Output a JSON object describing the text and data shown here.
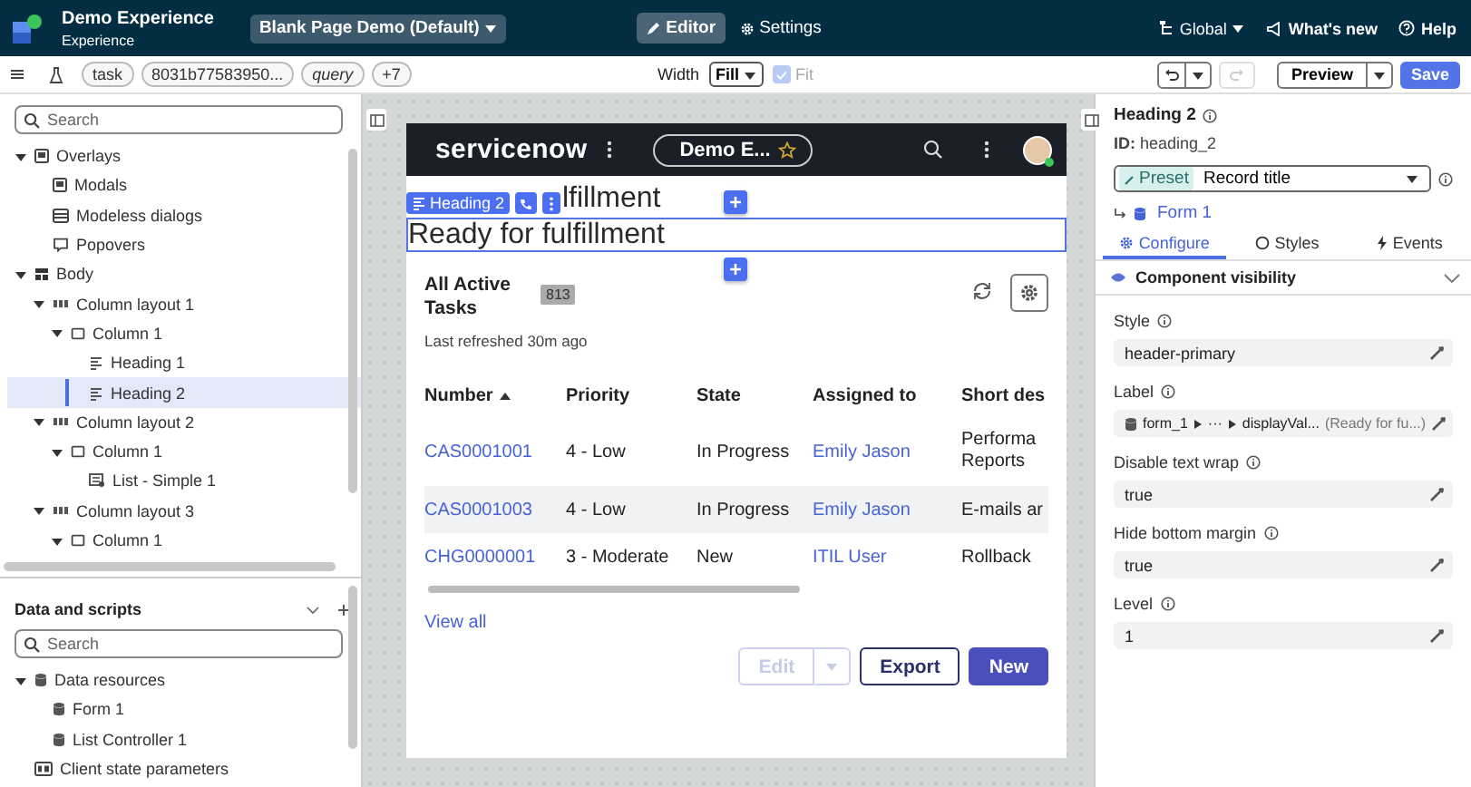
{
  "header": {
    "title": "Demo Experience",
    "subtitle": "Experience",
    "page_select": "Blank Page Demo (Default)",
    "tabs": [
      {
        "label": "Editor",
        "kind": "edit",
        "selected": true
      },
      {
        "label": "Settings",
        "kind": "settings",
        "selected": false
      }
    ],
    "links": [
      {
        "label": "Global",
        "kind": "scope"
      },
      {
        "label": "What's new",
        "kind": "news"
      },
      {
        "label": "Help",
        "kind": "help"
      }
    ]
  },
  "toolbar": {
    "params": [
      {
        "label": "task",
        "kind": "plain"
      },
      {
        "label": "8031b77583950...",
        "kind": "plain"
      },
      {
        "label": "query",
        "kind": "italic"
      },
      {
        "label": "+7",
        "kind": "plain"
      }
    ],
    "width_label": "Width",
    "width_value": "Fill",
    "fit": {
      "label": "Fit",
      "checked": true,
      "disabled": true
    },
    "undo": {
      "disabled": false
    },
    "redo": {
      "disabled": true
    },
    "preview": "Preview",
    "save": "Save"
  },
  "outline": {
    "search_placeholder": "Search",
    "tree": [
      {
        "label": "Overlays",
        "kind": "overlay",
        "expanded": true,
        "selected": false,
        "children": [
          {
            "label": "Modals",
            "kind": "overlay",
            "selected": false
          },
          {
            "label": "Modeless dialogs",
            "kind": "dialog",
            "selected": false
          },
          {
            "label": "Popovers",
            "kind": "popover",
            "selected": false
          }
        ]
      },
      {
        "label": "Body",
        "kind": "body",
        "expanded": true,
        "selected": false,
        "children": [
          {
            "label": "Column layout 1",
            "kind": "layout",
            "expanded": true,
            "selected": false,
            "children": [
              {
                "label": "Column 1",
                "kind": "column",
                "expanded": true,
                "selected": false,
                "children": [
                  {
                    "label": "Heading 1",
                    "kind": "heading",
                    "selected": false
                  },
                  {
                    "label": "Heading 2",
                    "kind": "heading",
                    "selected": true
                  }
                ]
              }
            ]
          },
          {
            "label": "Column layout 2",
            "kind": "layout",
            "expanded": true,
            "selected": false,
            "children": [
              {
                "label": "Column 1",
                "kind": "column",
                "expanded": true,
                "selected": false,
                "children": [
                  {
                    "label": "List - Simple 1",
                    "kind": "list",
                    "selected": false
                  }
                ]
              }
            ]
          },
          {
            "label": "Column layout 3",
            "kind": "layout",
            "expanded": true,
            "selected": false,
            "children": [
              {
                "label": "Column 1",
                "kind": "column",
                "expanded": true,
                "selected": false
              }
            ]
          }
        ]
      }
    ]
  },
  "data_scripts": {
    "title": "Data and scripts",
    "search_placeholder": "Search",
    "tree": [
      {
        "label": "Data resources",
        "kind": "data",
        "expanded": true,
        "selected": false,
        "children": [
          {
            "label": "Form 1",
            "kind": "data",
            "selected": false
          },
          {
            "label": "List Controller 1",
            "kind": "data",
            "selected": false
          }
        ]
      },
      {
        "label": "Client state parameters",
        "kind": "state",
        "selected": false
      }
    ]
  },
  "canvas": {
    "app_bar": {
      "logo": "servicenow",
      "pill": "Demo E..."
    },
    "chip": "Heading 2",
    "heading_1": "lfillment",
    "heading_2": "Ready for fulfillment",
    "list": {
      "title": "All Active Tasks",
      "count": "813",
      "refreshed": "Last refreshed 30m ago",
      "columns": [
        {
          "label": "Number",
          "kind": "link",
          "sorted": true
        },
        {
          "label": "Priority",
          "kind": "text",
          "sorted": false
        },
        {
          "label": "State",
          "kind": "text",
          "sorted": false
        },
        {
          "label": "Assigned to",
          "kind": "link",
          "sorted": false
        },
        {
          "label": "Short des",
          "kind": "text",
          "sorted": false
        }
      ],
      "rows": [
        {
          "cells": [
            "CAS0001001",
            "4 - Low",
            "In Progress",
            "Emily Jason",
            "Performa Reports"
          ],
          "highlighted": false
        },
        {
          "cells": [
            "CAS0001003",
            "4 - Low",
            "In Progress",
            "Emily Jason",
            "E-mails ar"
          ],
          "highlighted": true
        },
        {
          "cells": [
            "CHG0000001",
            "3 - Moderate",
            "New",
            "ITIL User",
            "Rollback"
          ],
          "highlighted": false
        }
      ],
      "view_all": "View all",
      "buttons": [
        {
          "label": "Edit",
          "kind": "split",
          "disabled": true
        },
        {
          "label": "Export",
          "kind": "outline",
          "disabled": false
        },
        {
          "label": "New",
          "kind": "primary",
          "disabled": false
        }
      ]
    }
  },
  "properties": {
    "title": "Heading 2",
    "id": "**ID:** heading_2",
    "preset": {
      "tag": "Preset",
      "value": "Record title"
    },
    "source": "Form 1",
    "tabs": [
      {
        "label": "Configure",
        "kind": "configure",
        "selected": true
      },
      {
        "label": "Styles",
        "kind": "styles",
        "selected": false
      },
      {
        "label": "Events",
        "kind": "events",
        "selected": false
      }
    ],
    "section": {
      "title": "Component visibility",
      "expanded": true
    },
    "fields": [
      {
        "label": "Style",
        "kind": "text",
        "value": "header-primary"
      },
      {
        "label": "Label",
        "kind": "binding",
        "path": [
          "form_1",
          "···",
          "displayVal..."
        ],
        "preview": "(Ready for fu...)"
      },
      {
        "label": "Disable text wrap",
        "kind": "text",
        "value": "true"
      },
      {
        "label": "Hide bottom margin",
        "kind": "text",
        "value": "true"
      },
      {
        "label": "Level",
        "kind": "text",
        "value": "1"
      }
    ]
  }
}
